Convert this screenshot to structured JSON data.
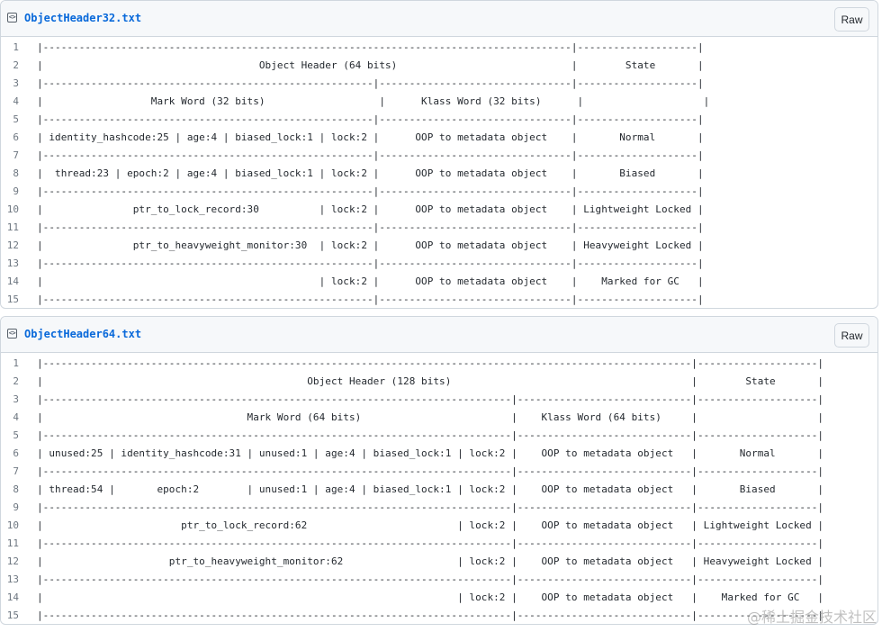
{
  "files": [
    {
      "name": "ObjectHeader32.txt",
      "raw_label": "Raw",
      "icon": "code-file-icon",
      "lines": [
        "|----------------------------------------------------------------------------------------|--------------------|",
        "|                                    Object Header (64 bits)                             |        State       |",
        "|-------------------------------------------------------|--------------------------------|--------------------|",
        "|                  Mark Word (32 bits)                   |      Klass Word (32 bits)      |                    |",
        "|-------------------------------------------------------|--------------------------------|--------------------|",
        "| identity_hashcode:25 | age:4 | biased_lock:1 | lock:2 |      OOP to metadata object    |       Normal       |",
        "|-------------------------------------------------------|--------------------------------|--------------------|",
        "|  thread:23 | epoch:2 | age:4 | biased_lock:1 | lock:2 |      OOP to metadata object    |       Biased       |",
        "|-------------------------------------------------------|--------------------------------|--------------------|",
        "|               ptr_to_lock_record:30          | lock:2 |      OOP to metadata object    | Lightweight Locked |",
        "|-------------------------------------------------------|--------------------------------|--------------------|",
        "|               ptr_to_heavyweight_monitor:30  | lock:2 |      OOP to metadata object    | Heavyweight Locked |",
        "|-------------------------------------------------------|--------------------------------|--------------------|",
        "|                                              | lock:2 |      OOP to metadata object    |    Marked for GC   |",
        "|-------------------------------------------------------|--------------------------------|--------------------|"
      ]
    },
    {
      "name": "ObjectHeader64.txt",
      "raw_label": "Raw",
      "icon": "code-file-icon",
      "lines": [
        "|------------------------------------------------------------------------------------------------------------|--------------------|",
        "|                                            Object Header (128 bits)                                        |        State       |",
        "|------------------------------------------------------------------------------|-----------------------------|--------------------|",
        "|                                  Mark Word (64 bits)                         |    Klass Word (64 bits)     |                    |",
        "|------------------------------------------------------------------------------|-----------------------------|--------------------|",
        "| unused:25 | identity_hashcode:31 | unused:1 | age:4 | biased_lock:1 | lock:2 |    OOP to metadata object   |       Normal       |",
        "|------------------------------------------------------------------------------|-----------------------------|--------------------|",
        "| thread:54 |       epoch:2        | unused:1 | age:4 | biased_lock:1 | lock:2 |    OOP to metadata object   |       Biased       |",
        "|------------------------------------------------------------------------------|-----------------------------|--------------------|",
        "|                       ptr_to_lock_record:62                         | lock:2 |    OOP to metadata object   | Lightweight Locked |",
        "|------------------------------------------------------------------------------|-----------------------------|--------------------|",
        "|                     ptr_to_heavyweight_monitor:62                   | lock:2 |    OOP to metadata object   | Heavyweight Locked |",
        "|------------------------------------------------------------------------------|-----------------------------|--------------------|",
        "|                                                                     | lock:2 |    OOP to metadata object   |    Marked for GC   |",
        "|------------------------------------------------------------------------------|-----------------------------|--------------------|"
      ]
    }
  ],
  "watermark": "@稀土掘金技术社区"
}
